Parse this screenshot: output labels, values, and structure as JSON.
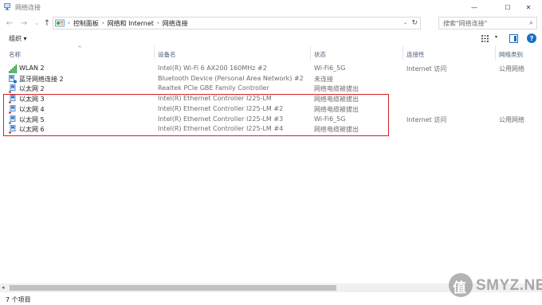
{
  "window": {
    "title": "网络连接",
    "minimize_glyph": "—",
    "maximize_glyph": "☐",
    "close_glyph": "✕"
  },
  "nav": {
    "back_glyph": "←",
    "forward_glyph": "→",
    "recent_glyph": "⌄",
    "up_glyph": "↑",
    "breadcrumb": [
      "控制面板",
      "网络和 Internet",
      "网络连接"
    ],
    "breadcrumb_sep": "›",
    "dropdown_glyph": "⌄",
    "refresh_glyph": "↻",
    "search_placeholder": "搜索\"网络连接\"",
    "search_glyph": "⌕"
  },
  "toolbar": {
    "organize_label": "组织 ▾",
    "view_dropdown_glyph": "▾",
    "help_glyph": "?"
  },
  "columns": {
    "name": "名称",
    "device": "设备名",
    "status": "状态",
    "connectivity": "连接性",
    "category": "网络类别",
    "sort_glyph": "^"
  },
  "rows": [
    {
      "name": "WLAN 2",
      "icon": "wifi-signal-icon",
      "device": "Intel(R) Wi-Fi 6 AX200 160MHz #2",
      "status": "Wi-Fi6_5G",
      "connectivity": "Internet 访问",
      "category": "公用网络"
    },
    {
      "name": "蓝牙网络连接 2",
      "icon": "bluetooth-network-icon",
      "device": "Bluetooth Device (Personal Area Network) #2",
      "status": "未连接",
      "connectivity": "",
      "category": ""
    },
    {
      "name": "以太网 2",
      "icon": "ethernet-adapter-icon",
      "device": "Realtek PCIe GBE Family Controller",
      "status": "网络电缆被拔出",
      "connectivity": "",
      "category": ""
    },
    {
      "name": "以太网 3",
      "icon": "ethernet-adapter-icon",
      "device": "Intel(R) Ethernet Controller I225-LM",
      "status": "网络电缆被拔出",
      "connectivity": "",
      "category": ""
    },
    {
      "name": "以太网 4",
      "icon": "ethernet-adapter-icon",
      "device": "Intel(R) Ethernet Controller I225-LM #2",
      "status": "网络电缆被拔出",
      "connectivity": "",
      "category": ""
    },
    {
      "name": "以太网 5",
      "icon": "ethernet-adapter-icon",
      "device": "Intel(R) Ethernet Controller I225-LM #3",
      "status": "Wi-Fi6_5G",
      "connectivity": "Internet 访问",
      "category": "公用网络"
    },
    {
      "name": "以太网 6",
      "icon": "ethernet-adapter-icon",
      "device": "Intel(R) Ethernet Controller I225-LM #4",
      "status": "网络电缆被拔出",
      "connectivity": "",
      "category": ""
    }
  ],
  "scrollbar": {
    "left_glyph": "◂",
    "right_glyph": "▸"
  },
  "statusbar": {
    "item_count": "7 个项目"
  },
  "watermark": {
    "text": "SMYZ.NET",
    "badge_text": "值"
  },
  "colors": {
    "highlight": "#d5202a",
    "accent": "#1a6fc4"
  }
}
